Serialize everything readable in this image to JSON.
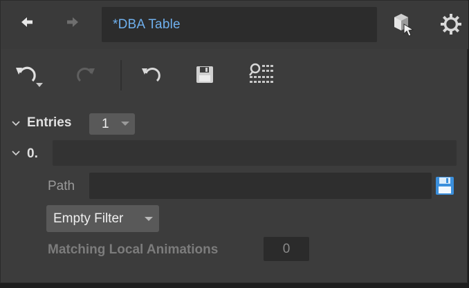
{
  "header": {
    "title": "*DBA Table",
    "back_icon": "arrow-left-icon",
    "forward_icon": "arrow-right-icon",
    "asset_icon": "asset-cursor-icon",
    "settings_icon": "gear-icon"
  },
  "toolbar": {
    "undo_icon": "undo-icon",
    "redo_icon": "redo-icon",
    "revert_icon": "revert-icon",
    "save_icon": "save-icon",
    "filter_icon": "search-list-icon"
  },
  "properties": {
    "entries_label": "Entries",
    "entries_value": "1",
    "entry_index": "0.",
    "entry_value": "",
    "path_label": "Path",
    "path_value": "",
    "filter_value": "Empty Filter",
    "matching_label": "Matching Local Animations",
    "matching_value": "0"
  },
  "colors": {
    "panel_bg": "#3c3c3c",
    "title_text": "#6fb0ee",
    "field_bg": "#2e2e2e"
  }
}
